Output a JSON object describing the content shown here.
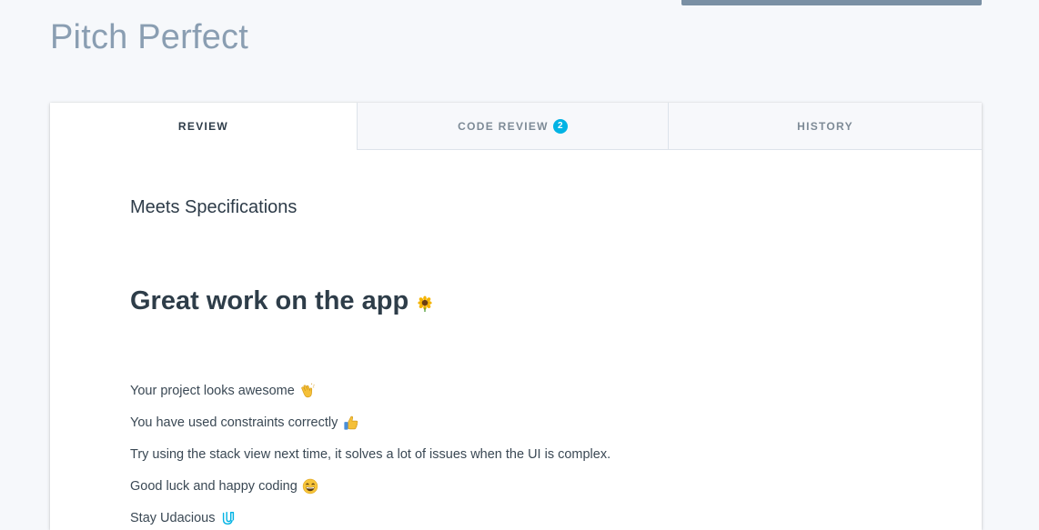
{
  "page": {
    "title": "Pitch Perfect"
  },
  "tabs": [
    {
      "label": "REVIEW",
      "active": true
    },
    {
      "label": "CODE REVIEW",
      "badge": "2",
      "active": false
    },
    {
      "label": "HISTORY",
      "active": false
    }
  ],
  "review": {
    "status": "Meets Specifications",
    "heading": "Great work on the app",
    "heading_icon": "sunflower-icon",
    "paragraphs": [
      {
        "text": "Your project looks awesome",
        "icon": "clapping-hands-icon"
      },
      {
        "text": "You have used constraints correctly",
        "icon": "thumbs-up-icon"
      },
      {
        "text": "Try using the stack view next time, it solves a lot of issues when the UI is complex.",
        "icon": ""
      },
      {
        "text": "Good luck and happy coding",
        "icon": "grinning-face-icon"
      },
      {
        "text": "Stay Udacious",
        "icon": "udacity-logo-icon"
      }
    ]
  },
  "colors": {
    "background": "#f6f8fb",
    "title": "#8a9eb2",
    "accent": "#02b3e4",
    "heading": "#2e3d49",
    "top_bar": "#7a90a4"
  }
}
